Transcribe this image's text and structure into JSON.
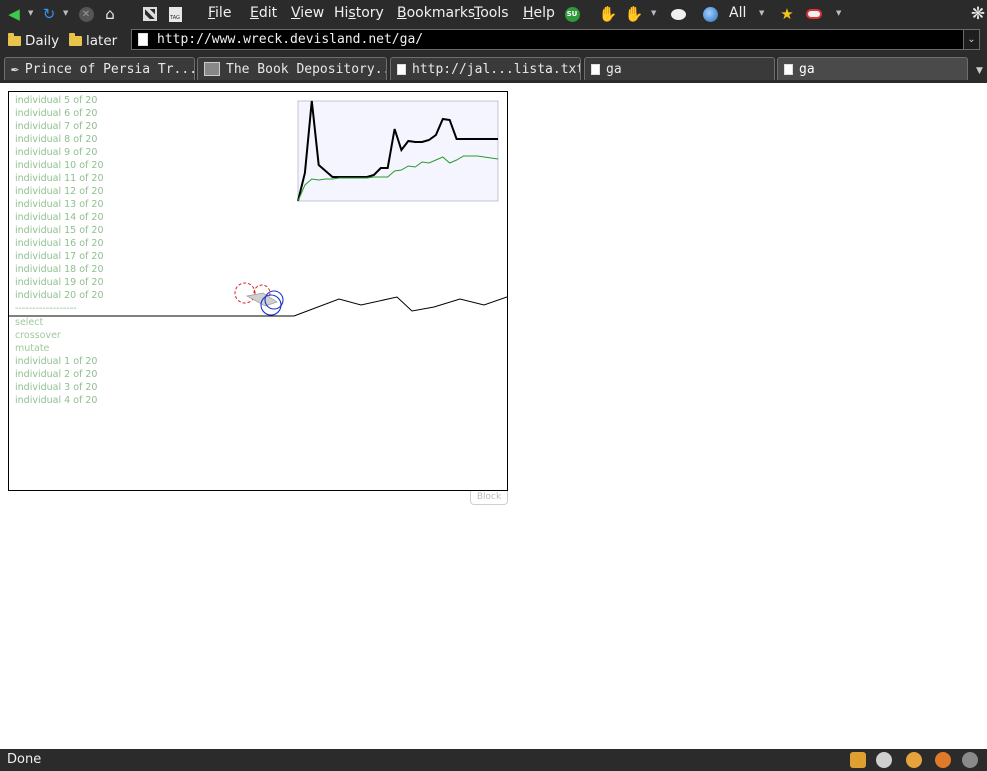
{
  "menubar": {
    "items": [
      {
        "label": "File",
        "underline": "F",
        "rest": "ile"
      },
      {
        "label": "Edit",
        "underline": "E",
        "rest": "dit"
      },
      {
        "label": "View",
        "underline": "V",
        "rest": "iew"
      },
      {
        "label": "History",
        "pre": "Hi",
        "underline": "s",
        "rest": "tory"
      },
      {
        "label": "Bookmarks",
        "underline": "B",
        "rest": "ookmarks"
      },
      {
        "label": "Tools",
        "underline": "T",
        "rest": "ools"
      },
      {
        "label": "Help",
        "underline": "H",
        "rest": "elp"
      }
    ],
    "search_engine_label": "All",
    "icons": [
      "back-icon",
      "reload-icon",
      "stop-icon",
      "home-icon",
      "qr-icon",
      "tag-icon",
      "stumbleupon-icon",
      "thumbs-up-icon",
      "thumbs-down-icon",
      "speech-bubble-icon",
      "globe-icon",
      "star-icon",
      "addon-icon",
      "throbber-icon"
    ]
  },
  "bookmarks": {
    "items": [
      {
        "label": "Daily"
      },
      {
        "label": "later"
      }
    ]
  },
  "urlbar": {
    "url": "http://www.wreck.devisland.net/ga/"
  },
  "tabs": [
    {
      "label": "Prince of Persia Tr...",
      "icon": "feather-icon",
      "active": false
    },
    {
      "label": "The Book Depository...",
      "icon": "book-depository-icon",
      "active": false
    },
    {
      "label": "http://jal...lista.txt",
      "icon": "document-icon",
      "active": false
    },
    {
      "label": "ga",
      "icon": "document-icon",
      "active": false
    },
    {
      "label": "ga",
      "icon": "document-icon",
      "active": true
    }
  ],
  "ga": {
    "log_top": [
      "individual 5 of 20",
      "individual 6 of 20",
      "individual 7 of 20",
      "individual 8 of 20",
      "individual 9 of 20",
      "individual 10 of 20",
      "individual 11 of 20",
      "individual 12 of 20",
      "individual 13 of 20",
      "individual 14 of 20",
      "individual 15 of 20",
      "individual 16 of 20",
      "individual 17 of 20",
      "individual 18 of 20",
      "individual 19 of 20",
      "individual 20 of 20",
      "------------------"
    ],
    "log_bottom": [
      "select",
      "crossover",
      "mutate",
      "individual 1 of 20",
      "individual 2 of 20",
      "individual 3 of 20",
      "individual 4 of 20"
    ],
    "block_label": "Block",
    "colors": {
      "best_line": "#000000",
      "average_line": "#2a9a2a",
      "chart_bg": "#f4f5ff",
      "wheel_front": "#1a33cc",
      "wheel_back": "#dd2222",
      "log_text": "#8fbf8f"
    }
  },
  "chart_data": {
    "type": "line",
    "title": "",
    "xlabel": "",
    "ylabel": "",
    "x": [
      0,
      1,
      2,
      3,
      4,
      5,
      6,
      7,
      8,
      9,
      10,
      11,
      12,
      13,
      14,
      15,
      16,
      17,
      18,
      19,
      20,
      21,
      22,
      23,
      24,
      25,
      26,
      27,
      28,
      29
    ],
    "ylim": [
      0,
      100
    ],
    "series": [
      {
        "values": [
          0,
          28,
          100,
          36,
          30,
          24,
          24,
          24,
          24,
          24,
          24,
          26,
          33,
          33,
          72,
          51,
          60,
          59,
          59,
          61,
          66,
          82,
          81,
          62,
          62,
          62,
          62,
          62,
          62,
          62
        ]
      },
      {
        "values": [
          0,
          16,
          22,
          21,
          22,
          22,
          23,
          23,
          23,
          23,
          23,
          24,
          24,
          24,
          30,
          31,
          35,
          34,
          39,
          38,
          41,
          44,
          38,
          41,
          45,
          45,
          45,
          44,
          43,
          42
        ]
      }
    ]
  },
  "status": {
    "text": "Done"
  }
}
